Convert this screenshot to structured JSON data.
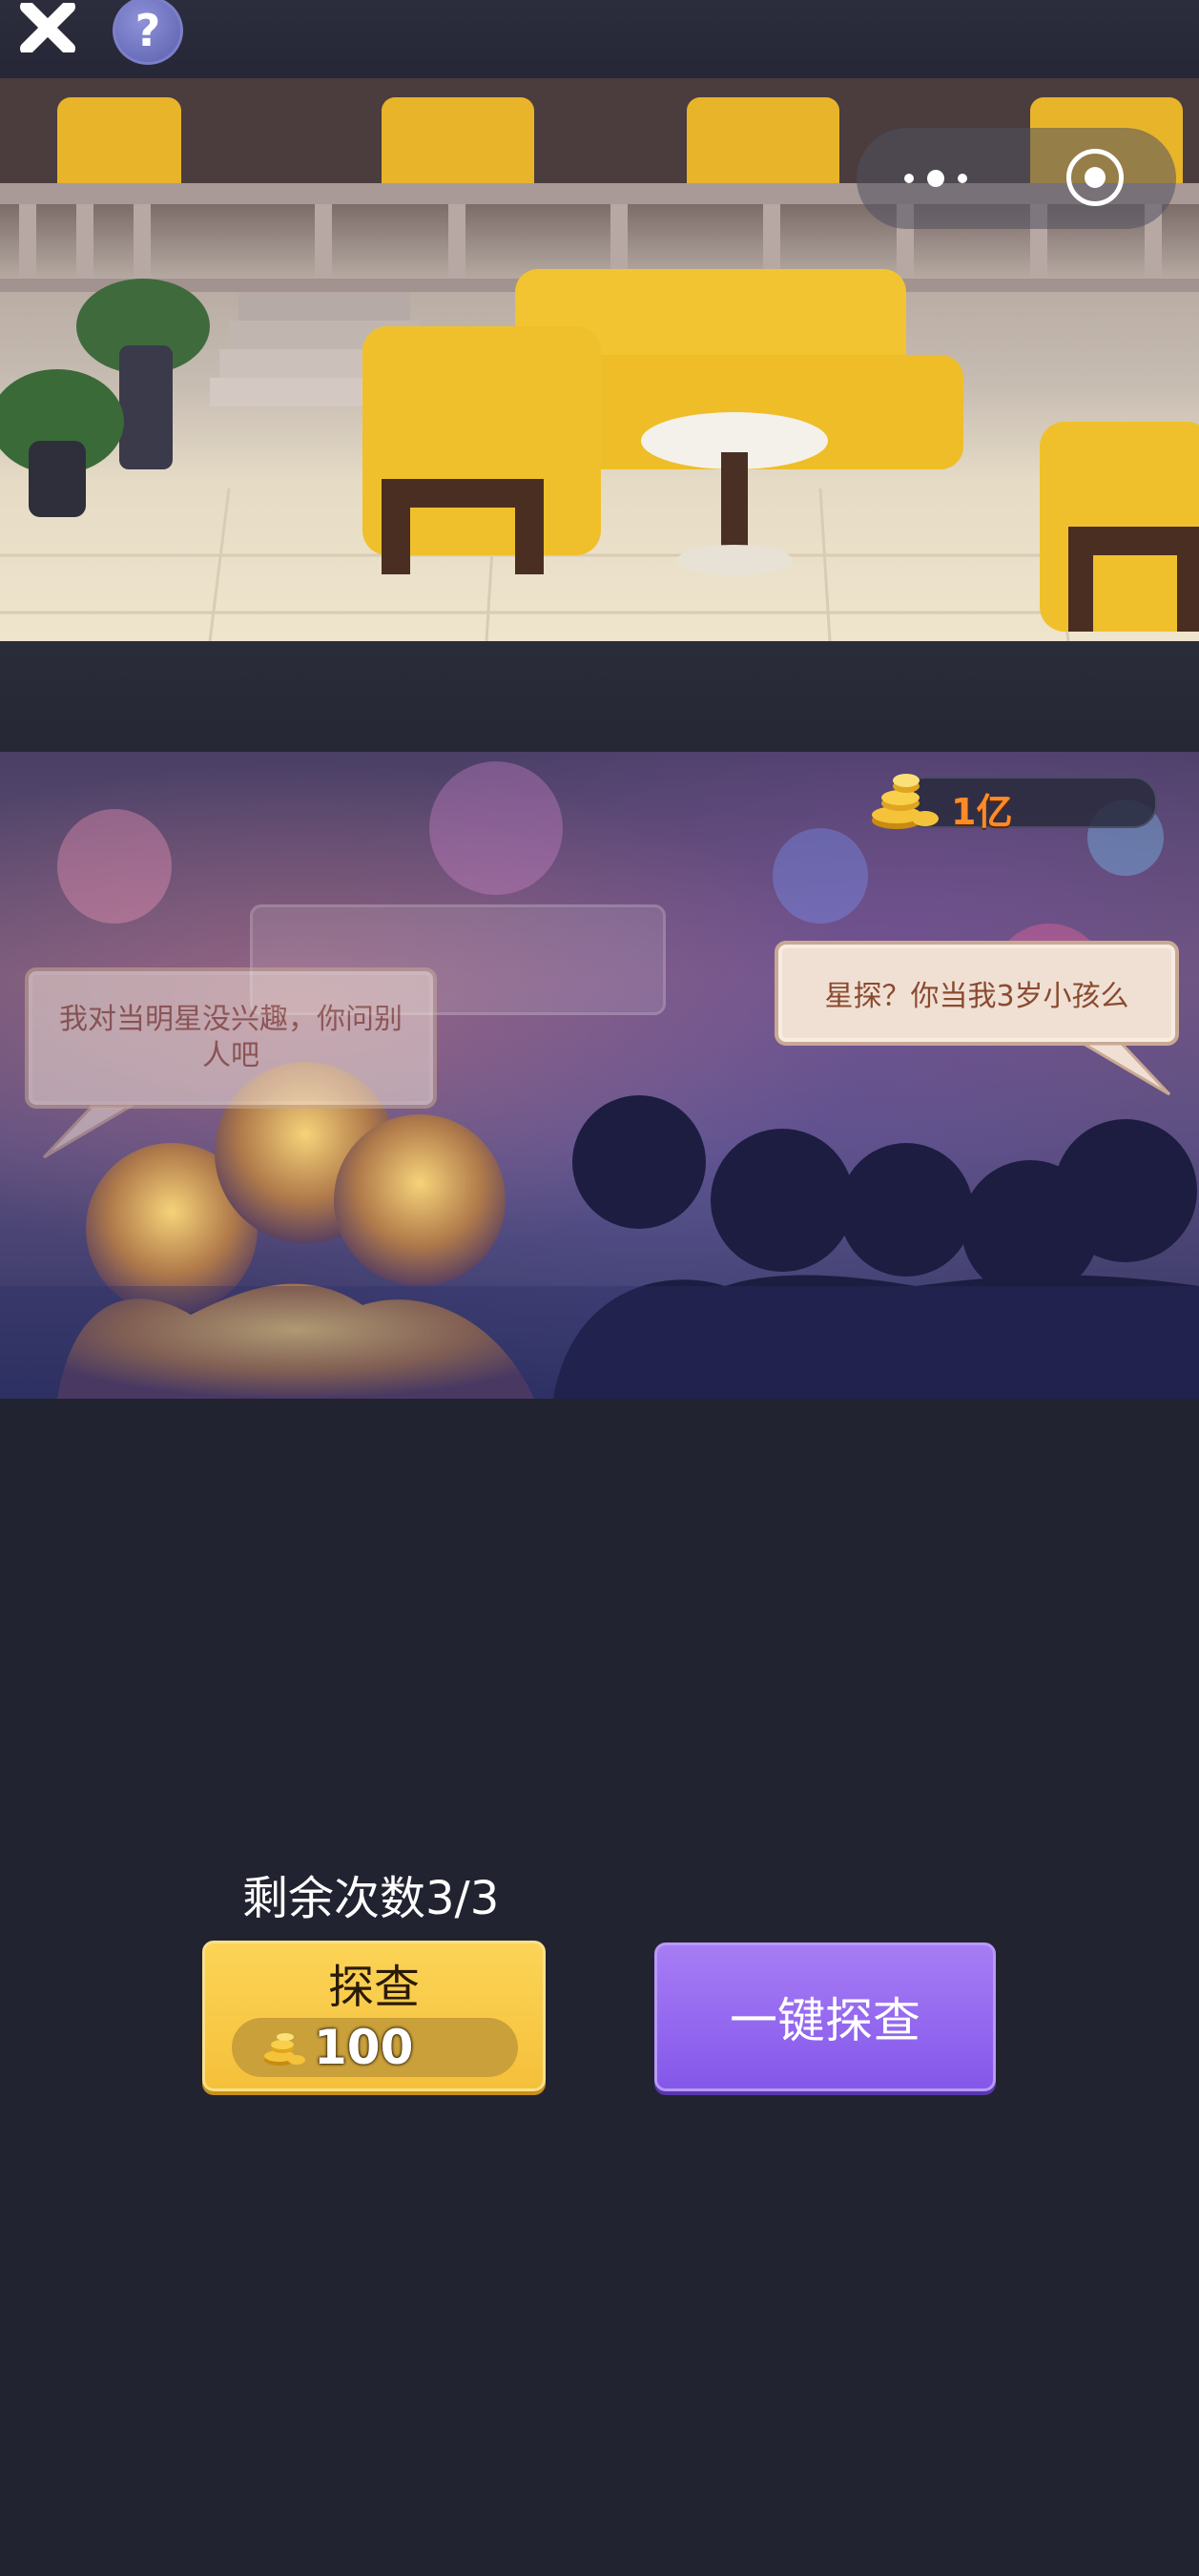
{
  "topbar": {
    "close_icon": "close-icon",
    "help_label": "?"
  },
  "scene": {
    "lobby_alt": "hotel lobby with yellow sofas",
    "menu_icon": "more-dots-icon",
    "target_icon": "target-icon"
  },
  "crowd": {
    "coins_value": "1亿",
    "coin_icon": "gold-coins-icon",
    "bubble_left": "我对当明星没兴趣，你问别人吧",
    "bubble_right": "星探？你当我3岁小孩么"
  },
  "controls": {
    "remaining_label": "剩余次数3/3",
    "probe_label": "探查",
    "probe_cost": "100",
    "onekey_label": "一键探查"
  },
  "colors": {
    "background": "#222331",
    "probe_button": "#f5c03a",
    "onekey_button": "#8c5eed",
    "coin_text": "#ff8a2a"
  }
}
